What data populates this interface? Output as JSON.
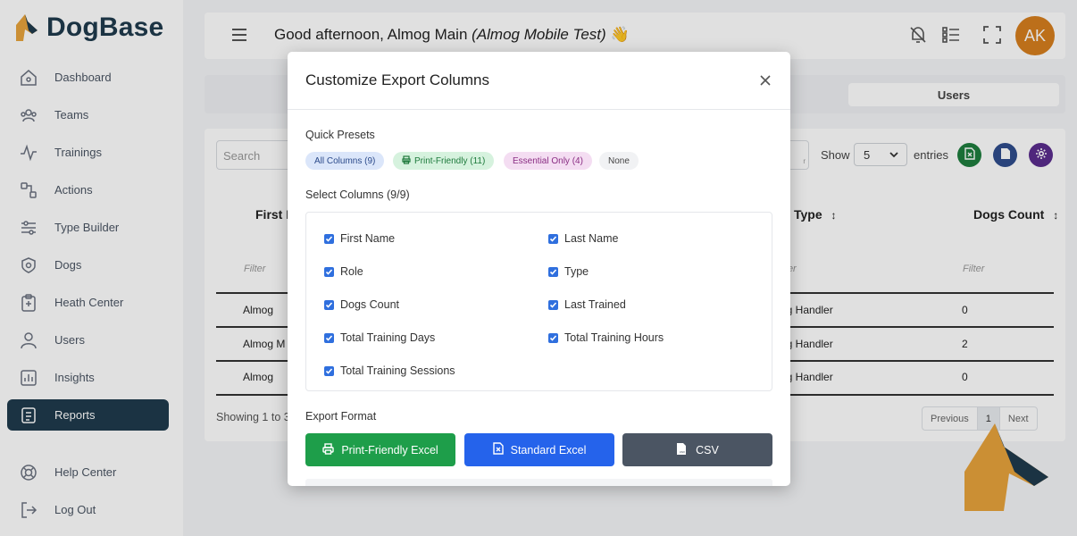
{
  "brand": {
    "name": "DogBase"
  },
  "sidebar": {
    "items": [
      {
        "label": "Dashboard",
        "icon": "home-icon"
      },
      {
        "label": "Teams",
        "icon": "users-group-icon"
      },
      {
        "label": "Trainings",
        "icon": "activity-icon"
      },
      {
        "label": "Actions",
        "icon": "actions-icon"
      },
      {
        "label": "Type Builder",
        "icon": "sliders-icon"
      },
      {
        "label": "Dogs",
        "icon": "dog-badge-icon"
      },
      {
        "label": "Heath Center",
        "icon": "clipboard-icon"
      },
      {
        "label": "Users",
        "icon": "user-icon"
      },
      {
        "label": "Insights",
        "icon": "chart-icon"
      },
      {
        "label": "Reports",
        "icon": "report-icon",
        "active": true
      }
    ],
    "bottom": [
      {
        "label": "Help Center",
        "icon": "lifebuoy-icon"
      },
      {
        "label": "Log Out",
        "icon": "logout-icon"
      }
    ]
  },
  "header": {
    "greeting": "Good afternoon, Almog Main",
    "org": "(Almog Mobile Test)",
    "emoji": "👋",
    "avatar_initials": "AK",
    "avatar_color": "#d77f1e"
  },
  "tabs": {
    "active": "Users"
  },
  "table": {
    "search_placeholder": "Search",
    "filter_hint": "r",
    "show_label": "Show",
    "entries_value": "5",
    "entries_label": "entries",
    "headers": {
      "first_name": "First N",
      "type": "Type",
      "dogs_count": "Dogs Count"
    },
    "filter_label": "Filter",
    "rows": [
      {
        "first": "Almog",
        "type": "og Handler",
        "dogs": "0"
      },
      {
        "first": "Almog M",
        "type": "og Handler",
        "dogs": "2"
      },
      {
        "first": "Almog",
        "type": "og Handler",
        "dogs": "0"
      }
    ],
    "showing": "Showing 1 to 3",
    "pager": {
      "prev": "Previous",
      "page": "1",
      "next": "Next"
    }
  },
  "modal": {
    "title": "Customize Export Columns",
    "presets_label": "Quick Presets",
    "presets": [
      {
        "label": "All Columns (9)"
      },
      {
        "label": "Print-Friendly (11)"
      },
      {
        "label": "Essential Only (4)"
      },
      {
        "label": "None"
      }
    ],
    "select_label": "Select Columns (9/9)",
    "columns": [
      "First Name",
      "Last Name",
      "Role",
      "Type",
      "Dogs Count",
      "Last Trained",
      "Total Training Days",
      "Total Training Hours",
      "Total Training Sessions"
    ],
    "format_label": "Export Format",
    "formats": [
      {
        "label": "Print-Friendly Excel",
        "color": "#1e9e4a"
      },
      {
        "label": "Standard Excel",
        "color": "#2563eb"
      },
      {
        "label": "CSV",
        "color": "#4b5563"
      }
    ]
  }
}
